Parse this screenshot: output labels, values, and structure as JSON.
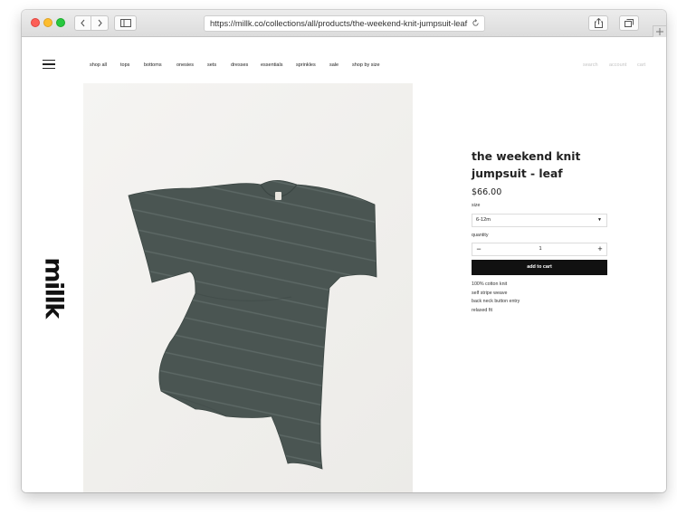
{
  "browser": {
    "url": "https://millk.co/collections/all/products/the-weekend-knit-jumpsuit-leaf"
  },
  "nav": {
    "items": [
      {
        "label": "shop all"
      },
      {
        "label": "tops"
      },
      {
        "label": "bottoms"
      },
      {
        "label": "onesies"
      },
      {
        "label": "sets"
      },
      {
        "label": "dresses"
      },
      {
        "label": "essentials"
      },
      {
        "label": "sprinkles"
      },
      {
        "label": "sale"
      },
      {
        "label": "shop by size"
      }
    ],
    "utility": [
      {
        "label": "search"
      },
      {
        "label": "account"
      },
      {
        "label": "cart"
      }
    ]
  },
  "brand": {
    "logo": "millk"
  },
  "product": {
    "title": "the weekend knit jumpsuit - leaf",
    "price": "$66.00",
    "size_label": "size",
    "size_value": "6-12m",
    "quantity_label": "quantity",
    "quantity_value": "1",
    "add_to_cart": "add to cart",
    "garment_color": "#4a5552",
    "description": [
      "100% cotton knit",
      "self stripe weave",
      "back neck button entry",
      "relaxed fit"
    ]
  }
}
